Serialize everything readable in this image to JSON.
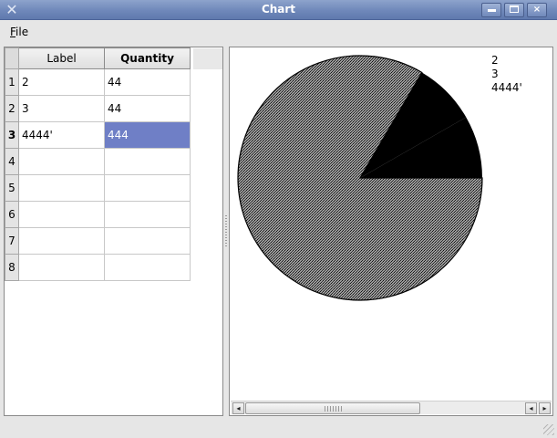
{
  "window": {
    "title": "Chart",
    "app_icon": "x-icon",
    "controls": {
      "minimize": "minimize-icon",
      "maximize": "maximize-icon",
      "close": "×"
    }
  },
  "menu": {
    "file_mnemonic": "F",
    "file_rest": "ile"
  },
  "table": {
    "columns": [
      "Label",
      "Quantity"
    ],
    "row_numbers": [
      "1",
      "2",
      "3",
      "4",
      "5",
      "6",
      "7",
      "8"
    ],
    "rows": [
      {
        "label": "2",
        "quantity": "44"
      },
      {
        "label": "3",
        "quantity": "44"
      },
      {
        "label": "4444'",
        "quantity": "444"
      },
      {
        "label": "",
        "quantity": ""
      },
      {
        "label": "",
        "quantity": ""
      },
      {
        "label": "",
        "quantity": ""
      },
      {
        "label": "",
        "quantity": ""
      },
      {
        "label": "",
        "quantity": ""
      }
    ],
    "selected_row": 3
  },
  "chart_data": {
    "type": "pie",
    "legend": [
      "2",
      "3",
      "4444'"
    ],
    "slices": [
      {
        "label": "2",
        "value": 44,
        "fill": "#000000"
      },
      {
        "label": "3",
        "value": 44,
        "fill": "#000000"
      },
      {
        "label": "4444'",
        "value": 444,
        "fill": "pattern"
      }
    ],
    "legend_position": "top-right",
    "colors": {
      "slice_solid": "#000000",
      "slice_pattern": "#7a7a7a",
      "outline": "#000000"
    }
  },
  "scrollbar": {
    "left_arrow": "◂",
    "right_arrow": "▸"
  }
}
